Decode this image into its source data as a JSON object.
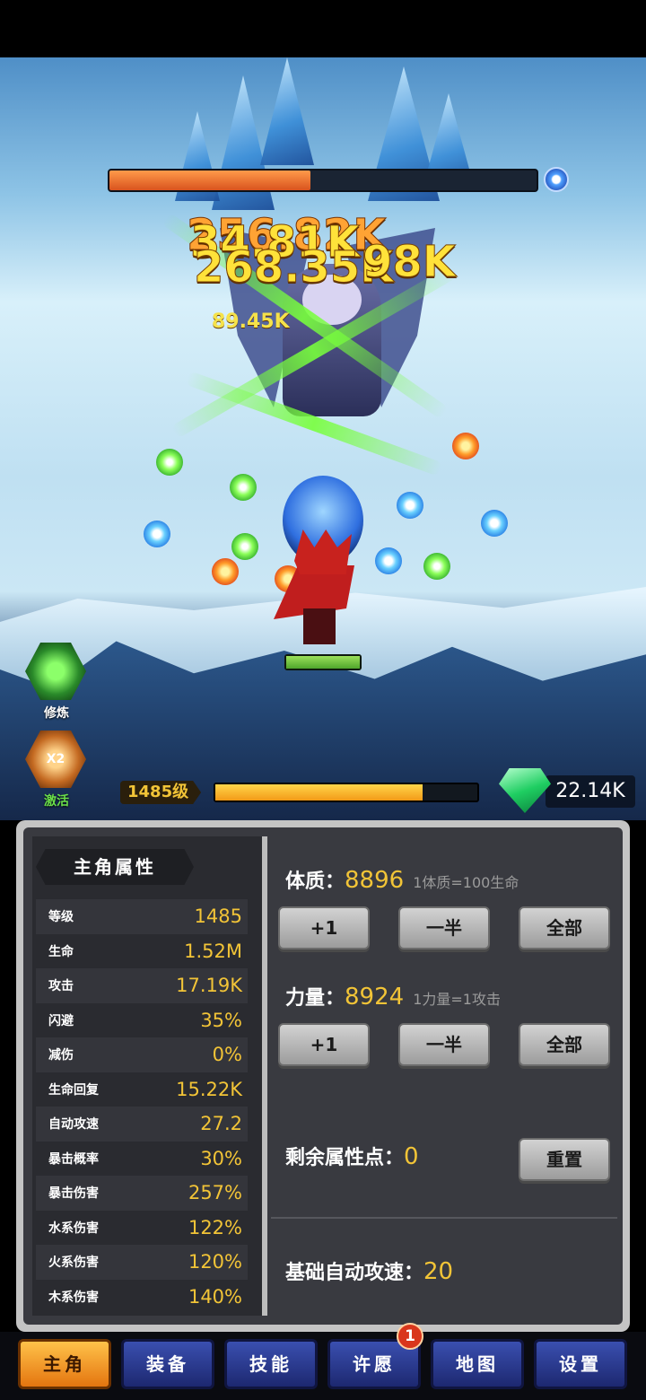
{
  "battle": {
    "boss_hp_fraction": 0.47,
    "damage_numbers": {
      "a": "34.81K",
      "b": "256.82K",
      "c": "268.35K",
      "d": "98K",
      "e": "89.45K"
    }
  },
  "skills": {
    "refine_label": "修炼",
    "boost_badge": "X2",
    "boost_label": "激活"
  },
  "player": {
    "level": "1485级",
    "exp_fraction": 0.79,
    "gems": "22.14K"
  },
  "attributes": {
    "title": "主角属性",
    "stats": [
      {
        "label": "等级",
        "value": "1485"
      },
      {
        "label": "生命",
        "value": "1.52M"
      },
      {
        "label": "攻击",
        "value": "17.19K"
      },
      {
        "label": "闪避",
        "value": "35%"
      },
      {
        "label": "减伤",
        "value": "0%"
      },
      {
        "label": "生命回复",
        "value": "15.22K"
      },
      {
        "label": "自动攻速",
        "value": "27.2"
      },
      {
        "label": "暴击概率",
        "value": "30%"
      },
      {
        "label": "暴击伤害",
        "value": "257%"
      },
      {
        "label": "水系伤害",
        "value": "122%"
      },
      {
        "label": "火系伤害",
        "value": "120%"
      },
      {
        "label": "木系伤害",
        "value": "140%"
      }
    ]
  },
  "allocation": {
    "constitution": {
      "label": "体质：",
      "value": "8896",
      "hint": "1体质=100生命"
    },
    "strength": {
      "label": "力量：",
      "value": "8924",
      "hint": "1力量=1攻击"
    },
    "buttons": {
      "plus_one": "+1",
      "half": "一半",
      "all": "全部"
    },
    "remaining_label": "剩余属性点：",
    "remaining_value": "0",
    "reset_label": "重置",
    "base_speed_label": "基础自动攻速：",
    "base_speed_value": "20"
  },
  "nav": {
    "tabs": [
      "主角",
      "装备",
      "技能",
      "许愿",
      "地图",
      "设置"
    ],
    "wish_badge": "1"
  }
}
